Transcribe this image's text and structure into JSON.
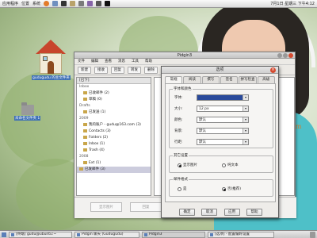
{
  "colors": {
    "panel": "#e6e6e6",
    "selection": "#2a4a9b",
    "close": "#d54a2f"
  },
  "top_panel": {
    "menus": [
      "应用程序",
      "位置",
      "系统"
    ],
    "clock": "7月1日 星期三 下午4:12"
  },
  "desktop": {
    "home_icon_label": "gudugudu 的主文件夹",
    "folder_icon_label": "未命名文件夹 1"
  },
  "mail_window": {
    "title": "Pidgin3",
    "menus": [
      "文件",
      "编辑",
      "查看",
      "消息",
      "工具",
      "帮助"
    ],
    "toolbar": [
      "新建",
      "接收",
      "回复",
      "转发",
      "删除"
    ],
    "folder_header": "[已下]",
    "folders": [
      {
        "label": "Inbox",
        "type": "group"
      },
      {
        "label": "已收邮件 (2)",
        "type": "item"
      },
      {
        "label": "草稿 (0)",
        "type": "item"
      },
      {
        "label": "Drafts",
        "type": "group"
      },
      {
        "label": "已发送 (1)",
        "type": "item"
      },
      {
        "label": "2009",
        "type": "group"
      },
      {
        "label": "我的账户 - gudu@163.com (3)",
        "type": "item"
      },
      {
        "label": "Contacts (3)",
        "type": "item"
      },
      {
        "label": "Folders (2)",
        "type": "item"
      },
      {
        "label": "Inbox (1)",
        "type": "item"
      },
      {
        "label": "Trash (4)",
        "type": "item"
      },
      {
        "label": "2008",
        "type": "group"
      },
      {
        "label": "Ext (1)",
        "type": "item"
      },
      {
        "label": "已发邮件 (3)",
        "type": "item",
        "selected": true
      }
    ],
    "preview_buttons": [
      "显示图片",
      "回复",
      "转发"
    ]
  },
  "dialog": {
    "title": "选项",
    "tabs": [
      "常规",
      "阅读",
      "撰写",
      "签名",
      "拼写检查",
      "高级"
    ],
    "group1_legend": "字体和颜色",
    "rows": [
      {
        "label": "字体:",
        "value": "",
        "selected": true
      },
      {
        "label": "大小:",
        "value": "12 px"
      },
      {
        "label": "颜色:",
        "value": "默认"
      },
      {
        "label": "背景:",
        "value": "默认"
      },
      {
        "label": "行距:",
        "value": "默认"
      }
    ],
    "group2_legend": "其它设置",
    "group2_options": [
      {
        "label": "显示图片",
        "checked": true
      },
      {
        "label": "纯文本",
        "checked": false
      }
    ],
    "group3_legend": "邮件格式",
    "group3_options": [
      {
        "label": "是",
        "checked": false
      },
      {
        "label": "否(推荐)",
        "checked": true
      }
    ],
    "buttons": [
      "确定",
      "取消",
      "应用",
      "帮助"
    ]
  },
  "taskbar": {
    "tasks": [
      {
        "label": "[终端] gudu@ubuntu:~",
        "active": false
      },
      {
        "label": "Pidgin 聊天 (Gudugudu)",
        "active": false
      },
      {
        "label": "Pidgin3",
        "active": true
      },
      {
        "label": "[选项] - 配置偏好设置",
        "active": false
      }
    ]
  },
  "watermark": "MMvm"
}
